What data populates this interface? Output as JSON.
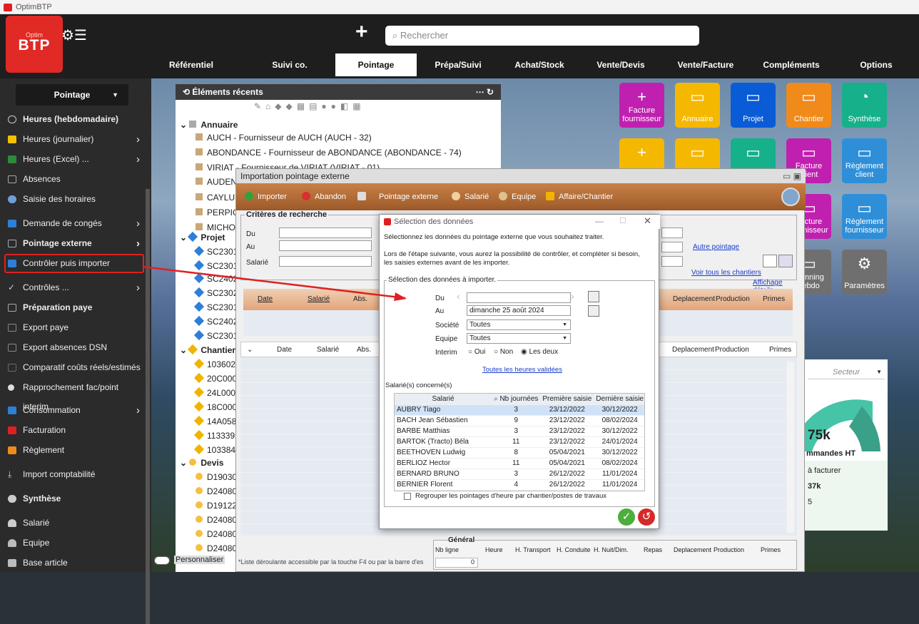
{
  "app": {
    "title": "OptimBTP",
    "logo_top": "Optim",
    "logo_main": "BTP"
  },
  "search": {
    "placeholder": "Rechercher"
  },
  "nav": [
    "Référentiel",
    "Suivi co.",
    "Pointage",
    "Prépa/Suivi",
    "Achat/Stock",
    "Vente/Devis",
    "Vente/Facture",
    "Compléments",
    "Options"
  ],
  "sidebar": {
    "header": "Pointage",
    "items": [
      {
        "label": "Heures (hebdomadaire)",
        "bold": true
      },
      {
        "label": "Heures (journalier)",
        "arrow": true
      },
      {
        "label": "Heures (Excel) ...",
        "arrow": true
      },
      {
        "label": "Absences"
      },
      {
        "label": "Saisie des horaires"
      },
      {
        "label": "Demande de congés",
        "arrow": true
      },
      {
        "label": "Pointage externe",
        "bold": true,
        "arrow": true
      },
      {
        "label": "Contrôler puis importer"
      },
      {
        "label": "Contrôles ...",
        "arrow": true
      },
      {
        "label": "Préparation paye",
        "bold": true
      },
      {
        "label": "Export paye"
      },
      {
        "label": "Export absences DSN"
      },
      {
        "label": "Comparatif coûts réels/estimés"
      },
      {
        "label": "Rapprochement fac/point interim"
      },
      {
        "label": "Consommation",
        "arrow": true
      },
      {
        "label": "Facturation"
      },
      {
        "label": "Règlement"
      },
      {
        "label": "Import comptabilité"
      },
      {
        "label": "Synthèse",
        "bold": true
      },
      {
        "label": "Salarié"
      },
      {
        "label": "Equipe"
      },
      {
        "label": "Base article"
      }
    ]
  },
  "recent": {
    "title": "Éléments récents",
    "annuaire": {
      "label": "Annuaire",
      "items": [
        "AUCH - Fournisseur de AUCH (AUCH - 32)",
        "ABONDANCE - Fournisseur de ABONDANCE (ABONDANCE - 74)",
        "VIRIAT - Fournisseur de VIRIAT (VIRIAT - 01)",
        "AUDEN",
        "CAYLUS",
        "PERPIG",
        "MICHO"
      ]
    },
    "projet": {
      "label": "Projet",
      "items": [
        "SC2301",
        "SC2301",
        "SC2402",
        "SC2302",
        "SC2301",
        "SC2402",
        "SC2301"
      ]
    },
    "chantier": {
      "label": "Chantier",
      "items": [
        "103602",
        "20C000",
        "24L000",
        "18C000",
        "14A058",
        "113339",
        "103384"
      ]
    },
    "devis": {
      "label": "Devis",
      "items": [
        "D19030",
        "D24080",
        "D19122",
        "D24080",
        "D24080",
        "D24080"
      ]
    },
    "personnaliser": "Personnaliser"
  },
  "tiles": [
    {
      "label": "Facture fournisseur",
      "icon": "+"
    },
    {
      "label": "Annuaire",
      "icon": "▭"
    },
    {
      "label": "Projet",
      "icon": "▭"
    },
    {
      "label": "Chantier",
      "icon": "▭"
    },
    {
      "label": "Synthèse",
      "icon": "◔"
    },
    {
      "label": "",
      "icon": "+"
    },
    {
      "label": "",
      "icon": "▭"
    },
    {
      "label": "",
      "icon": "▭"
    },
    {
      "label": "Facture client",
      "icon": "▭"
    },
    {
      "label": "Règlement client",
      "icon": "▭"
    },
    {
      "label": "Facture fournisseur",
      "icon": "▭"
    },
    {
      "label": "Règlement fournisseur",
      "icon": "▭"
    },
    {
      "label": "Planning hebdo",
      "icon": "▭"
    },
    {
      "label": "Paramètres",
      "icon": "⚙"
    }
  ],
  "gauge": {
    "select_placeholder": "Secteur",
    "value": "75k",
    "label1": "mmandes HT",
    "label2": "à facturer",
    "value2": "37k",
    "value3": "5"
  },
  "import_window": {
    "title": "Importation pointage externe",
    "toolbar": [
      "Importer",
      "Abandon",
      "Pointage externe",
      "Salarié",
      "Equipe",
      "Affaire/Chantier"
    ],
    "criteria": "Critères de recherche",
    "du": "Du",
    "au": "Au",
    "salarie": "Salarié",
    "autre_pointage": "Autre pointage",
    "voir_chantiers": "Voir tous les chantiers",
    "affichage": "Affichage détails",
    "cols1": [
      "Date",
      "Salarié",
      "Abs."
    ],
    "cols1_right": [
      "Deplacement",
      "Production",
      "Primes"
    ],
    "cols2": [
      "Date",
      "Salarié",
      "Abs."
    ],
    "cols2_right": [
      "Deplacement",
      "Production",
      "Primes"
    ],
    "general": "Général",
    "general_cols": [
      "Nb ligne",
      "Heure",
      "H. Transport",
      "H. Conduite",
      "H. Nuit/Dim.",
      "Repas",
      "Deplacement",
      "Production",
      "Primes"
    ],
    "nb_ligne": "0",
    "footer_note": "*Liste déroulante accessible par la touche F4 ou par la barre d'es"
  },
  "dialog": {
    "title": "Sélection des données",
    "intro": "Sélectionnez les données du pointage externe que vous souhaitez traiter.",
    "info": "Lors de l'étape suivante, vous aurez la possibilité de contrôler, et compléter si besoin, les saisies externes avant de les importer.",
    "group": "Sélection des données à importer.",
    "du": "Du",
    "au": "Au",
    "au_value": "dimanche 25 août 2024",
    "societe": "Société",
    "societe_value": "Toutes",
    "equipe": "Equipe",
    "equipe_value": "Toutes",
    "interim": "Interim",
    "oui": "Oui",
    "non": "Non",
    "les_deux": "Les deux",
    "toutes_heures": "Toutes les heures validées",
    "salaries_label": "Salarié(s) concerné(s)",
    "columns": [
      "Salarié",
      "Nb journées",
      "Première saisie",
      "Dernière saisie"
    ],
    "rows": [
      [
        "AUBRY Tiago",
        "3",
        "23/12/2022",
        "30/12/2022"
      ],
      [
        "BACH Jean Sébastien",
        "9",
        "23/12/2022",
        "08/02/2024"
      ],
      [
        "BARBE Matthias",
        "3",
        "23/12/2022",
        "30/12/2022"
      ],
      [
        "BARTOK (Tracto) Béla",
        "11",
        "23/12/2022",
        "24/01/2024"
      ],
      [
        "BEETHOVEN Ludwig",
        "8",
        "05/04/2021",
        "30/12/2022"
      ],
      [
        "BERLIOZ Hector",
        "11",
        "05/04/2021",
        "08/02/2024"
      ],
      [
        "BERNARD BRUNO",
        "3",
        "26/12/2022",
        "11/01/2024"
      ],
      [
        "BERNIER Florent",
        "4",
        "26/12/2022",
        "11/01/2024"
      ]
    ],
    "regrouper": "Regrouper les pointages d'heure par chantier/postes de travaux"
  },
  "colors": {
    "accent_red": "#e02020",
    "tile_magenta": "#c020b0",
    "tile_yellow": "#f5b800",
    "tile_blue": "#0a5bd6",
    "tile_orange": "#f08a1a",
    "tile_teal": "#16b08a",
    "tile_gray": "#6f6f6f"
  }
}
